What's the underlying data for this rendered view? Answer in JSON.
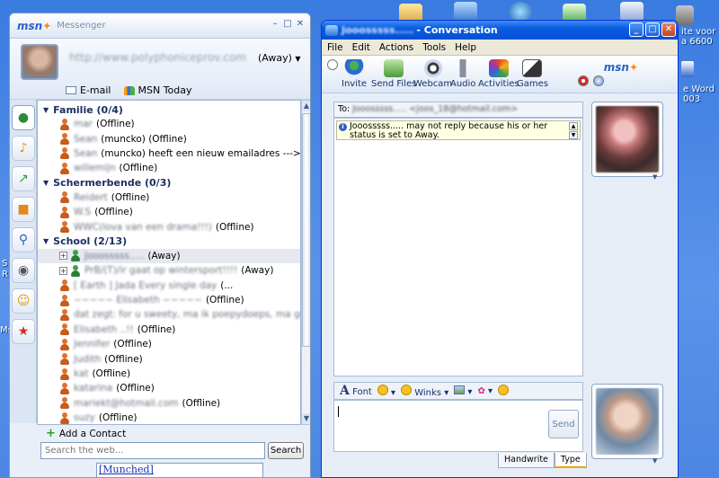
{
  "desktop": {
    "text_1": "ite voor",
    "text_2": "a 6600",
    "text_3": "e Word",
    "text_4": "003",
    "text_left_1": "S",
    "text_left_2": "R",
    "text_left_3": "Ms"
  },
  "messenger": {
    "app_label": "Messenger",
    "logo": "msn",
    "profile": {
      "display_name": "http://www.polyphoniceprov.com",
      "status": "(Away)"
    },
    "links": {
      "email": "E-mail",
      "msn_today": "MSN Today"
    },
    "groups": [
      {
        "title": "Familie (0/4)",
        "contacts": [
          {
            "name": "mar",
            "status": "(Offline)"
          },
          {
            "name": "Sean",
            "status": "(muncko) (Offline)"
          },
          {
            "name": "Sean",
            "status": "(muncko) heeft een nieuw emailadres ---> seandemu..."
          },
          {
            "name": "willemijn",
            "status": "(Offline)"
          }
        ]
      },
      {
        "title": "Schermerbende (0/3)",
        "contacts": [
          {
            "name": "Reidert",
            "status": "(Offline)"
          },
          {
            "name": "W.S",
            "status": "(Offline)"
          },
          {
            "name": "WWC(lova van een drama!!!)",
            "status": "(Offline)"
          }
        ]
      },
      {
        "title": "School (2/13)",
        "contacts": [
          {
            "name": "Jooosssss.....",
            "status": "(Away)"
          },
          {
            "name": "PrB/(T)/ir  gaat op wintersport!!!!",
            "status": "(Away)"
          },
          {
            "name": "[ Earth ]  Jada  Every single day",
            "status": "(..."
          },
          {
            "name": "~~~~~ Elisabeth ~~~~~",
            "status": "(Offline)"
          },
          {
            "name": "dat zegt: for u sweety, ma ik poepydoeps, ma gewoid weg...",
            "status": ""
          },
          {
            "name": "Elisabeth ..!!",
            "status": "(Offline)"
          },
          {
            "name": "Jennifer",
            "status": "(Offline)"
          },
          {
            "name": "Judith",
            "status": "(Offline)"
          },
          {
            "name": "kat",
            "status": "(Offline)"
          },
          {
            "name": "katarina",
            "status": "(Offline)"
          },
          {
            "name": "mariekt@hotmail.com",
            "status": "(Offline)"
          },
          {
            "name": "suzy",
            "status": "(Offline)"
          }
        ]
      }
    ],
    "add_contact": "Add a Contact",
    "search": {
      "placeholder": "Search the web...",
      "button": "Search"
    },
    "ad_text": "[Munched]"
  },
  "conversation": {
    "title_name": "Jooosssss.....",
    "title": "- Conversation",
    "menu": [
      "File",
      "Edit",
      "Actions",
      "Tools",
      "Help"
    ],
    "toolbar": [
      "Invite",
      "Send Files",
      "Webcam",
      "Audio",
      "Activities",
      "Games"
    ],
    "logo": "msn",
    "to_label": "To:",
    "to_value": "Jooosssss..... <joos_18@hotmail.com>",
    "notice": "Jooosssss..... may not reply because his or her status is set to Away.",
    "format": {
      "font": "Font",
      "winks": "Winks"
    },
    "send_button": "Send",
    "tabs": [
      "Handwrite",
      "Type"
    ],
    "active_tab": "Type"
  },
  "colors": {
    "desktop_blue": "#3a7be0",
    "title_blue": "#0450d6",
    "close_red": "#c2441f",
    "group_text": "#1a2f63",
    "online_green": "#3aa04a",
    "offline_orange": "#e0702a"
  },
  "icons": [
    "buddy-icon",
    "mail-icon",
    "msn-butterfly-icon",
    "info-icon",
    "webcam-icon",
    "audio-icon",
    "games-icon"
  ]
}
